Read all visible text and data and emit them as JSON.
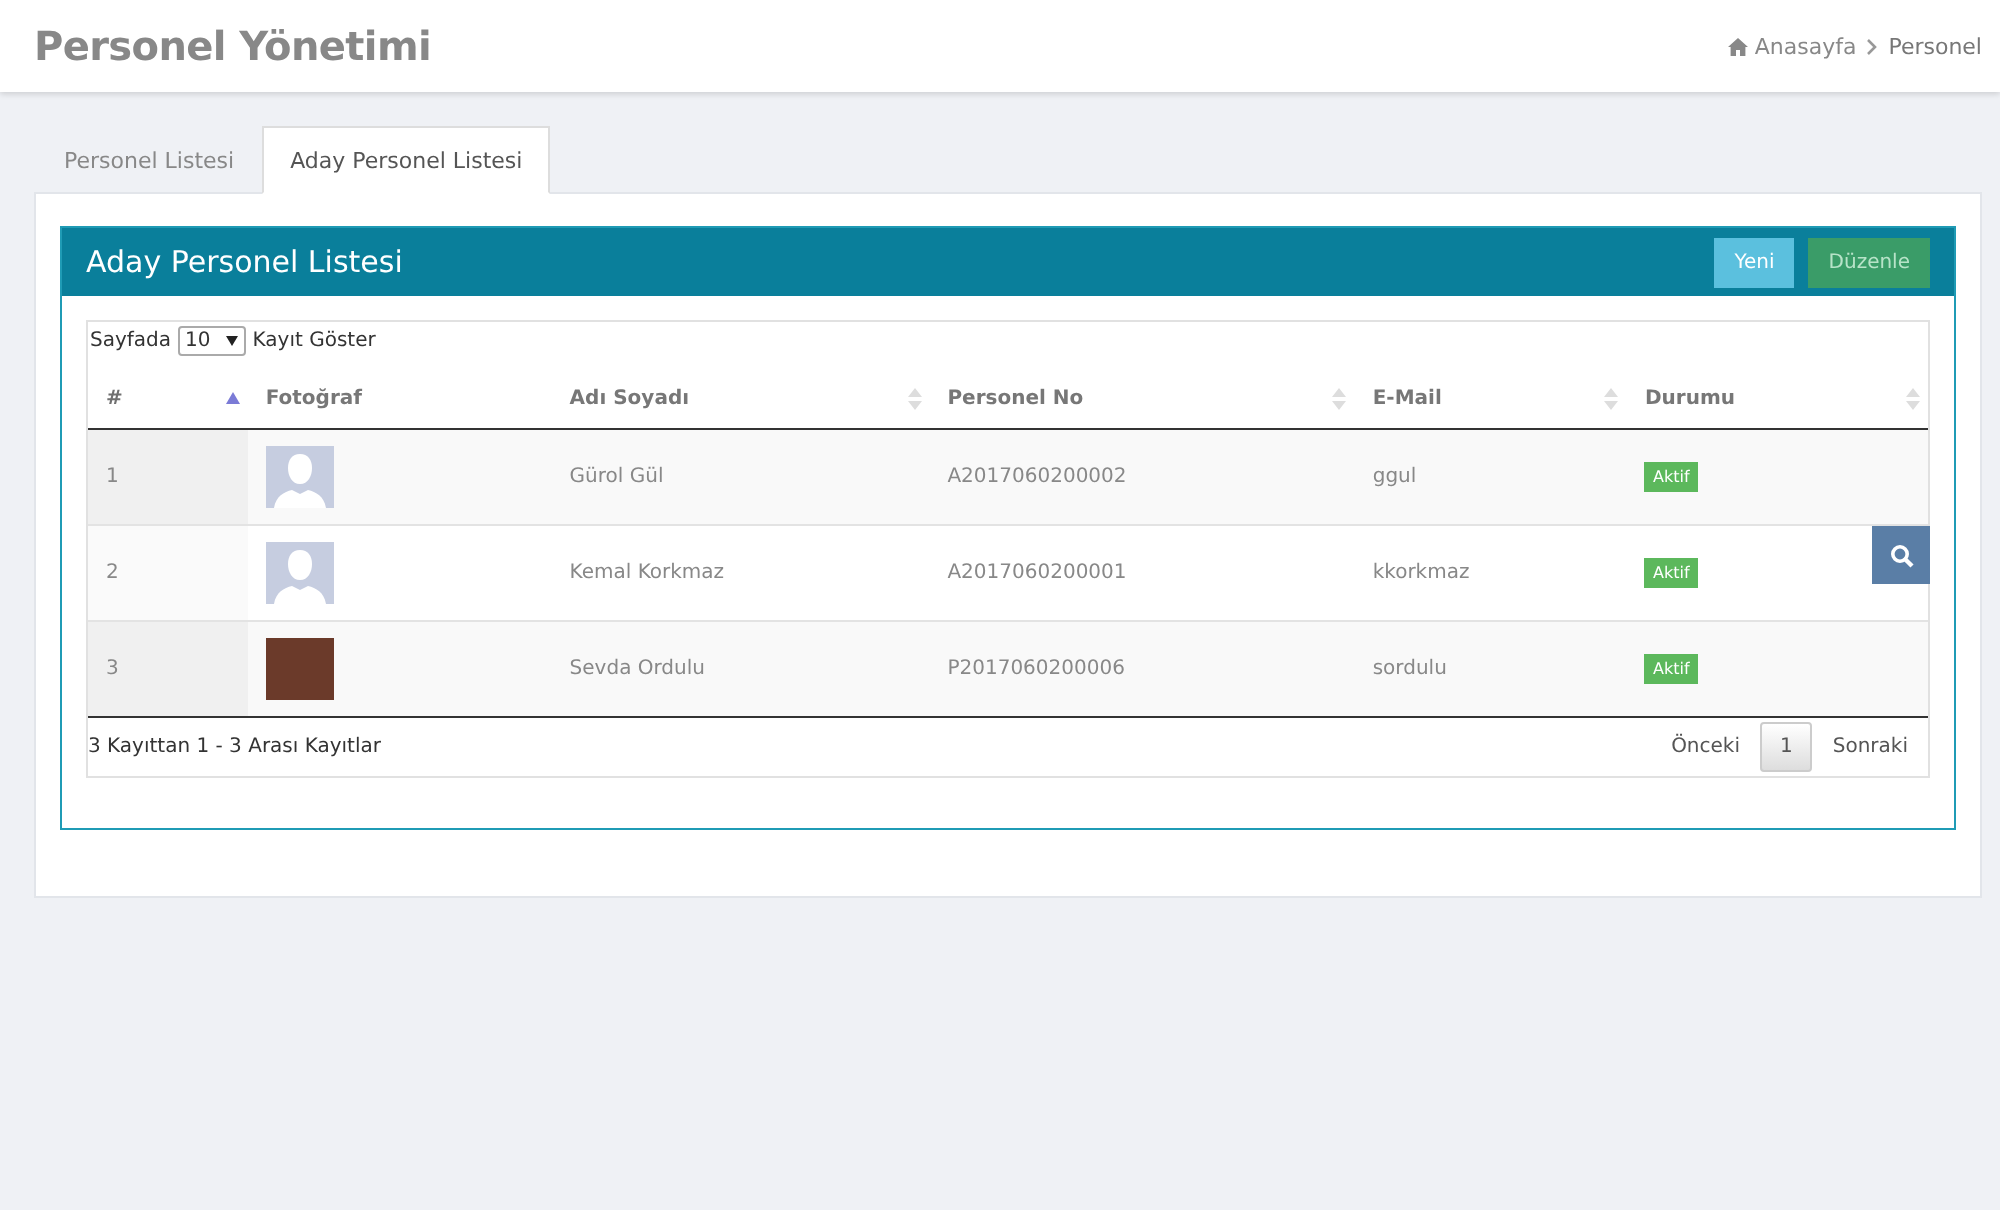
{
  "page_title": "Personel Yönetimi",
  "breadcrumb": [
    {
      "label": "Anasayfa",
      "kind": "home"
    },
    {
      "label": "Personel",
      "kind": "current"
    }
  ],
  "tabs": [
    {
      "label": "Personel Listesi",
      "selected": false
    },
    {
      "label": "Aday Personel Listesi",
      "selected": true
    }
  ],
  "panel": {
    "title": "Aday Personel Listesi",
    "buttons": [
      {
        "label": "Yeni",
        "kind": "info"
      },
      {
        "label": "Düzenle",
        "kind": "success"
      }
    ]
  },
  "table": {
    "length_prefix": "Sayfada",
    "length_value": "10",
    "length_suffix": "Kayıt Göster",
    "columns": [
      {
        "label": "#",
        "sortable": true,
        "sorted": true
      },
      {
        "label": "Fotoğraf",
        "sortable": false,
        "sorted": false
      },
      {
        "label": "Adı Soyadı",
        "sortable": true,
        "sorted": false
      },
      {
        "label": "Personel No",
        "sortable": true,
        "sorted": false
      },
      {
        "label": "E-Mail",
        "sortable": true,
        "sorted": false
      },
      {
        "label": "Durumu",
        "sortable": true,
        "sorted": false
      }
    ],
    "rows": [
      {
        "no": "1",
        "kind": "silhouette",
        "name": "Gürol Gül",
        "personnel_no": "A2017060200002",
        "email": "ggul",
        "status": "Aktif"
      },
      {
        "no": "2",
        "kind": "silhouette",
        "name": "Kemal Korkmaz",
        "personnel_no": "A2017060200001",
        "email": "kkorkmaz",
        "status": "Aktif"
      },
      {
        "no": "3",
        "kind": "photo",
        "name": "Sevda Ordulu",
        "personnel_no": "P2017060200006",
        "email": "sordulu",
        "status": "Aktif"
      }
    ],
    "info": "3 Kayıttan 1 - 3 Arası Kayıtlar",
    "pagination": [
      {
        "label": "Önceki",
        "selected": false
      },
      {
        "label": "1",
        "selected": true
      },
      {
        "label": "Sonraki",
        "selected": false
      }
    ]
  }
}
